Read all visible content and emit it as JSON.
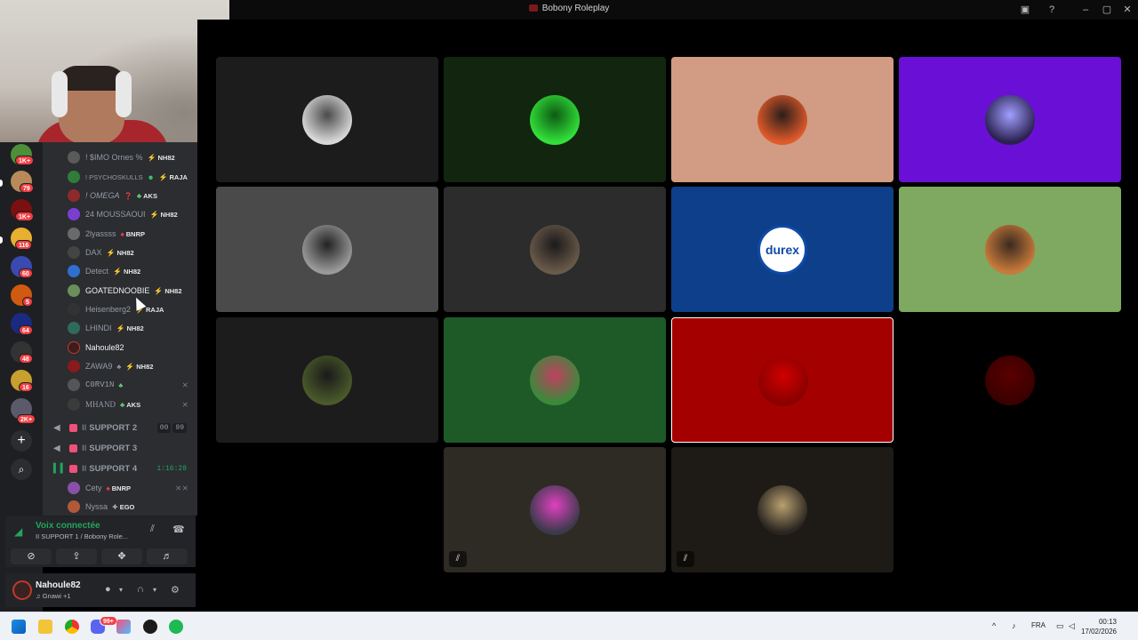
{
  "window": {
    "title": "Bobony Roleplay",
    "screen_share_icon": "screen-share-icon",
    "help_icon": "help-icon"
  },
  "rail": {
    "badges": [
      "1K+",
      "79",
      "1K+",
      "116",
      "60",
      "5",
      "64",
      "48",
      "16",
      "2K+"
    ],
    "add_label": "+",
    "discover_label": "⌕"
  },
  "members_top": [
    {
      "name": "! $IMO Ornes %",
      "tag": "NH82",
      "tag_icon": "⚡",
      "avatar_color": "#5a5a5a"
    },
    {
      "name": "! PSYCHOSKULLS",
      "tag": "RAJA",
      "tag_icon": "⚡",
      "avatar_color": "#2f7d3b",
      "extra": "☻"
    },
    {
      "name": "! OMEGA",
      "tag": "AKS",
      "tag_icon": "♣",
      "avatar_color": "#8e2a2a",
      "extra": "❓"
    },
    {
      "name": "24 MOUSSAOUI",
      "tag": "NH82",
      "tag_icon": "⚡",
      "avatar_color": "#7a3fd1"
    },
    {
      "name": "2lyassss",
      "tag": "BNRP",
      "tag_icon": "♠",
      "avatar_color": "#6a6a6a"
    },
    {
      "name": "DAX",
      "tag": "NH82",
      "tag_icon": "⚡",
      "avatar_color": "#444"
    },
    {
      "name": "Detect",
      "tag": "NH82",
      "tag_icon": "⚡",
      "avatar_color": "#2f6fd0"
    },
    {
      "name": "GOATEDNOOBIE",
      "tag": "NH82",
      "tag_icon": "⚡",
      "avatar_color": "#6b8f5a",
      "bright": true
    },
    {
      "name": "Heisenberg2",
      "tag": "RAJA",
      "tag_icon": "⚡",
      "avatar_color": "#333"
    },
    {
      "name": "LHINDI",
      "tag": "NH82",
      "tag_icon": "⚡",
      "avatar_color": "#2e6b5a"
    },
    {
      "name": "Nahoule82",
      "tag": "",
      "tag_icon": "",
      "avatar_color": "#3a1d1d",
      "bright": true
    },
    {
      "name": "ZAWA9",
      "tag": "NH82",
      "tag_icon": "⚡",
      "avatar_color": "#8b1a1a",
      "extra": "♣"
    },
    {
      "name": "C0RV1N",
      "tag": "",
      "tag_icon": "",
      "avatar_color": "#555",
      "extra": "♣",
      "muted": true
    },
    {
      "name": "MHAND",
      "tag": "AKS",
      "tag_icon": "♣",
      "avatar_color": "#3b3b3b",
      "muted": true
    }
  ],
  "voice_channels": [
    {
      "name": "SUPPORT 2",
      "prefix": "II",
      "right": "00",
      "count": "99"
    },
    {
      "name": "SUPPORT 3",
      "prefix": "II",
      "right": "",
      "count": ""
    },
    {
      "name": "SUPPORT 4",
      "prefix": "II",
      "right": "1:16:28",
      "count": "",
      "active": true
    }
  ],
  "members_bottom": [
    {
      "name": "Cety",
      "tag": "BNRP",
      "tag_icon": "♠",
      "avatar_color": "#8a4fa8",
      "muted": true
    },
    {
      "name": "Nyssa",
      "tag": "EGO",
      "tag_icon": "✧",
      "avatar_color": "#b05a3a"
    }
  ],
  "voice_panel": {
    "status": "Voix connectée",
    "channel": "II SUPPORT 1 / Bobony Role...",
    "buttons": [
      "camera-off-icon",
      "screen-share-icon",
      "activities-icon",
      "soundboard-icon"
    ]
  },
  "user_panel": {
    "name": "Nahoule82",
    "sub": "♫ Gnawi +1"
  },
  "tiles": [
    {
      "bg": "#1c1c1c",
      "avatar": "#d8d8d8",
      "avatar_accent": "#4a4a4a"
    },
    {
      "bg": "#12260f",
      "avatar": "#33e03a",
      "avatar_accent": "#0d5a12"
    },
    {
      "bg": "#d19b84",
      "avatar": "#e05a2a",
      "avatar_accent": "#2b1e1a"
    },
    {
      "bg": "#6a10d6",
      "avatar": "#2a2050",
      "avatar_accent": "#a0a0ff"
    },
    {
      "bg": "#4a4a4a",
      "avatar": "#9a9a9a",
      "avatar_accent": "#222"
    },
    {
      "bg": "#2c2c2c",
      "avatar": "#6a5a4a",
      "avatar_accent": "#1a1a1a"
    },
    {
      "bg": "#0d3f8a",
      "avatar": "durex",
      "avatar_accent": "#0f4aa8"
    },
    {
      "bg": "#7fa860",
      "avatar": "#c87a3a",
      "avatar_accent": "#3a2a20"
    },
    {
      "bg": "#1c1c1c",
      "avatar": "#4a5a2a",
      "avatar_accent": "#1a1a1a"
    },
    {
      "bg": "#1e5a28",
      "avatar": "#3a8a3a",
      "avatar_accent": "#c04060"
    },
    {
      "bg": "#a50000",
      "avatar": "#8a0000",
      "avatar_accent": "#d00000",
      "selected": true
    },
    {
      "bg": "#000000",
      "avatar": "#3a0000",
      "avatar_accent": "#5a0000"
    },
    {
      "bg": "#2e2a24",
      "avatar": "#3a3a4a",
      "avatar_accent": "#e040c0",
      "muted": true
    },
    {
      "bg": "#1e1b16",
      "avatar": "#2a2520",
      "avatar_accent": "#b8a070",
      "muted": true
    }
  ],
  "taskbar": {
    "lang": "FRA",
    "time": "00:13",
    "date": "17/02/2026",
    "up_arrow": "^",
    "discord_badge": "99+"
  },
  "durex_label": "durex"
}
